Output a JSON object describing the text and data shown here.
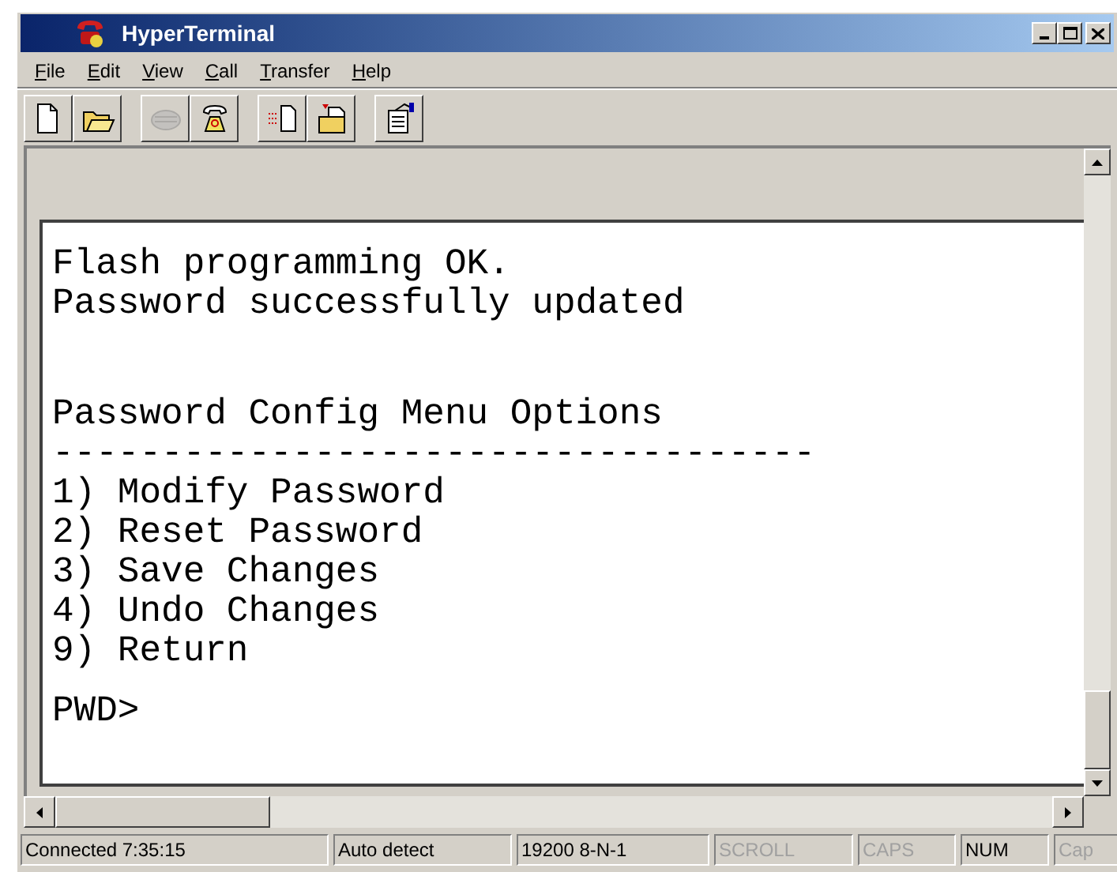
{
  "window": {
    "title": "HyperTerminal"
  },
  "menu": [
    {
      "label": "File"
    },
    {
      "label": "Edit"
    },
    {
      "label": "View"
    },
    {
      "label": "Call"
    },
    {
      "label": "Transfer"
    },
    {
      "label": "Help"
    }
  ],
  "toolbar": [
    {
      "kind": "new",
      "disabled": false
    },
    {
      "kind": "open",
      "disabled": false,
      "gap_before": false
    },
    {
      "kind": "disconnect",
      "disabled": true,
      "gap_before": true
    },
    {
      "kind": "dial",
      "disabled": false,
      "gap_before": false
    },
    {
      "kind": "send",
      "disabled": false,
      "gap_before": true
    },
    {
      "kind": "receive",
      "disabled": false,
      "gap_before": false
    },
    {
      "kind": "properties",
      "disabled": false,
      "gap_before": true
    }
  ],
  "terminal": {
    "blocks": [
      {
        "lines": [
          "Flash programming OK.",
          "Password successfully updated"
        ]
      },
      {
        "lines": [
          "Password Config Menu Options",
          "-----------------------------------",
          "1) Modify Password",
          "2) Reset Password",
          "3) Save Changes",
          "4) Undo Changes",
          "9) Return"
        ]
      },
      {
        "lines": [
          "PWD>"
        ]
      }
    ]
  },
  "status_bar": [
    {
      "text": "Connected 7:35:15",
      "active": true
    },
    {
      "text": "Auto detect",
      "active": true
    },
    {
      "text": "19200 8-N-1",
      "active": true
    },
    {
      "text": "SCROLL",
      "active": false
    },
    {
      "text": "CAPS",
      "active": false
    },
    {
      "text": "NUM",
      "active": true
    },
    {
      "text": "Cap",
      "active": false
    }
  ]
}
